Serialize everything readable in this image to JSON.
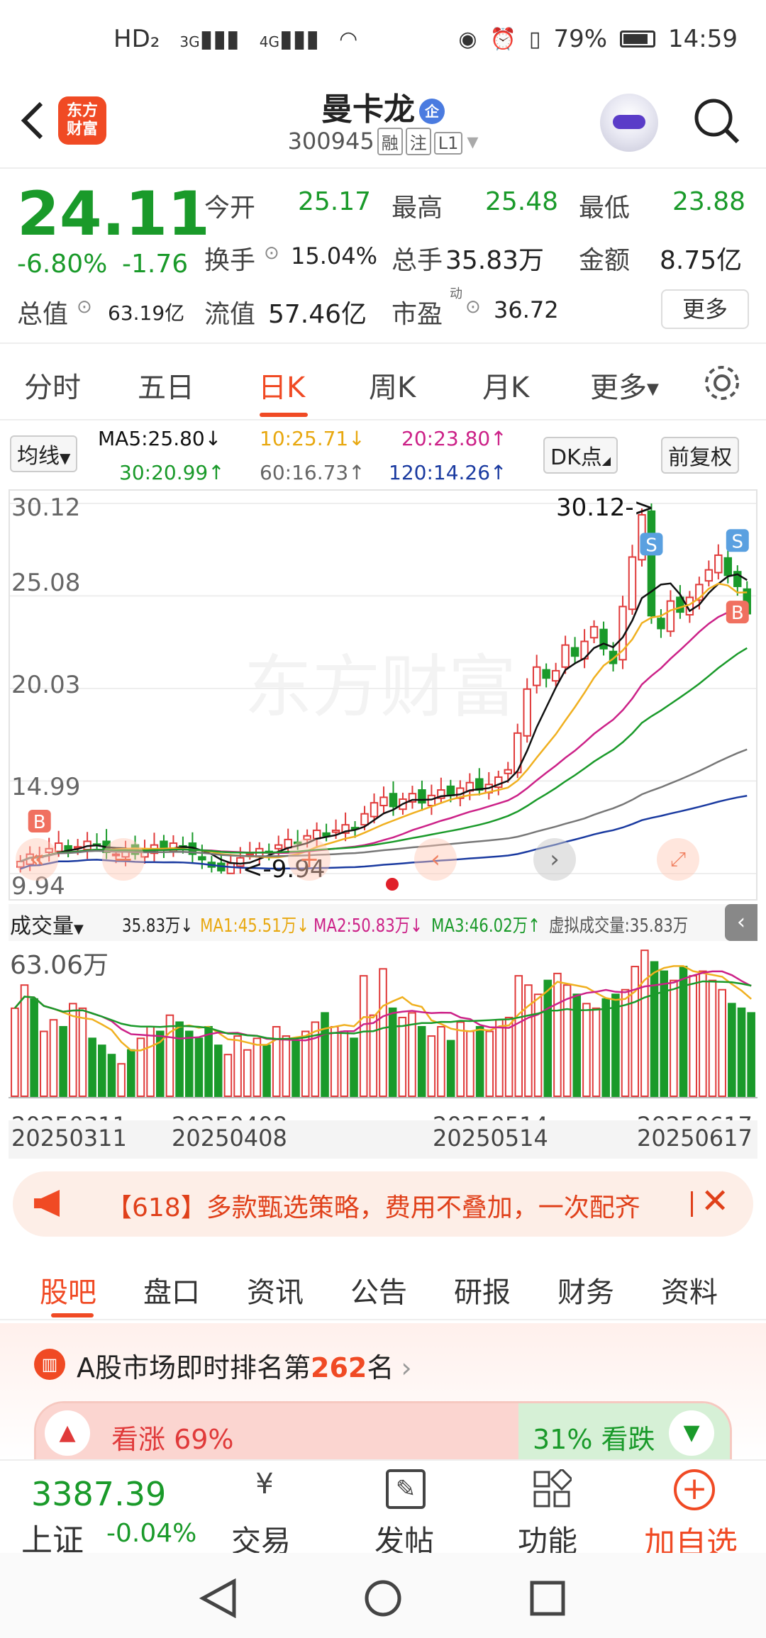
{
  "status_bar": {
    "net1": "HD₂",
    "net2": "3G",
    "net3": "4G",
    "battery": "79%",
    "time": "14:59"
  },
  "header": {
    "logo_text": "东方\n财富",
    "name": "曼卡龙",
    "corp_tag": "企",
    "code": "300945",
    "tags": [
      "融",
      "注",
      "L1"
    ]
  },
  "quote": {
    "price": "24.11",
    "change_pct": "-6.80%",
    "change": "-1.76",
    "open_label": "今开",
    "open": "25.17",
    "high_label": "最高",
    "high": "25.48",
    "low_label": "最低",
    "low": "23.88",
    "turnover_label": "换手",
    "turnover": "15.04%",
    "volume_label": "总手",
    "volume": "35.83万",
    "amount_label": "金额",
    "amount": "8.75亿",
    "mcap_label": "总值",
    "mcap": "63.19亿",
    "float_label": "流值",
    "float": "57.46亿",
    "pe_label": "市盈",
    "pe_sup": "动",
    "pe": "36.72",
    "more": "更多"
  },
  "chart_tabs": {
    "items": [
      "分时",
      "五日",
      "日K",
      "周K",
      "月K",
      "更多"
    ],
    "active": "日K"
  },
  "ma": {
    "selector": "均线",
    "ma5": "MA5:25.80",
    "ma10": "10:25.71",
    "ma20": "20:23.80",
    "ma30": "30:20.99",
    "ma60": "60:16.73",
    "ma120": "120:14.26",
    "dk": "DK点",
    "adjust": "前复权"
  },
  "colors": {
    "up": "#e03a3a",
    "down": "#1a9a2a",
    "accent": "#f04a24",
    "ma5": "#111111",
    "ma10": "#f0b020",
    "ma20": "#cc2288",
    "ma30": "#1a9a2a",
    "ma60": "#777777",
    "ma120": "#1a3aa0"
  },
  "kline": {
    "y_labels": [
      "30.12",
      "25.08",
      "20.03",
      "14.99",
      "9.94"
    ],
    "max_label": "30.12->",
    "min_label": "<-9.94",
    "watermark": "东方财富",
    "chart_data": {
      "type": "candlestick",
      "title": "",
      "ylim": [
        9.94,
        30.12
      ],
      "candles_close": [
        10.6,
        11.0,
        10.9,
        11.3,
        11.6,
        11.2,
        11.4,
        11.7,
        11.5,
        11.1,
        11.0,
        11.3,
        11.0,
        11.2,
        11.5,
        11.3,
        11.6,
        11.4,
        11.0,
        10.7,
        10.3,
        10.1,
        10.5,
        10.8,
        11.0,
        11.3,
        11.1,
        11.5,
        11.8,
        11.6,
        12.0,
        12.3,
        12.0,
        12.3,
        12.6,
        12.4,
        13.2,
        13.8,
        14.1,
        13.6,
        14.0,
        14.3,
        13.8,
        14.2,
        14.5,
        14.2,
        14.6,
        14.9,
        14.5,
        14.8,
        15.2,
        15.6,
        17.6,
        20.0,
        21.2,
        20.6,
        21.0,
        22.4,
        21.8,
        22.6,
        23.4,
        22.2,
        21.4,
        24.5,
        27.2,
        29.5,
        24.0,
        23.3,
        24.8,
        24.2,
        25.0,
        25.7,
        26.5,
        27.3,
        26.2,
        25.6,
        24.11
      ],
      "markers": [
        {
          "label": "B"
        },
        {
          "label": "S"
        },
        {
          "label": "B"
        },
        {
          "label": "S"
        }
      ]
    }
  },
  "volume": {
    "selector": "成交量",
    "cur": "35.83万",
    "ma1": "MA1:45.51万",
    "ma2": "MA2:50.83万",
    "ma3": "MA3:46.02万",
    "virtual": "虚拟成交量:35.83万",
    "max_label": "63.06万",
    "dates": [
      "20250311",
      "20250408",
      "20250514",
      "20250617"
    ],
    "chart_data": {
      "type": "bar",
      "values": [
        38,
        48,
        42,
        28,
        33,
        30,
        40,
        38,
        25,
        22,
        18,
        14,
        20,
        25,
        30,
        28,
        35,
        32,
        28,
        25,
        30,
        22,
        18,
        26,
        20,
        25,
        22,
        30,
        26,
        24,
        28,
        32,
        36,
        30,
        28,
        25,
        52,
        35,
        55,
        38,
        34,
        36,
        30,
        26,
        30,
        24,
        32,
        28,
        30,
        28,
        33,
        34,
        52,
        48,
        44,
        50,
        53,
        48,
        44,
        40,
        38,
        42,
        44,
        46,
        56,
        63,
        58,
        54,
        50,
        56,
        52,
        54,
        50,
        46,
        40,
        38,
        36
      ]
    }
  },
  "banner": {
    "text": "【618】多款甄选策略，费用不叠加，一次配齐"
  },
  "section_tabs": {
    "items": [
      "股吧",
      "盘口",
      "资讯",
      "公告",
      "研报",
      "财务",
      "资料"
    ],
    "active": "股吧"
  },
  "rank": {
    "prefix": "A股市场即时排名第",
    "num": "262",
    "suffix": "名",
    "up": "看涨 69%",
    "down": "31% 看跌"
  },
  "bottom": {
    "index_value": "3387.39",
    "index_name": "上证",
    "index_chg": "-0.04%",
    "trade": "交易",
    "post": "发帖",
    "func": "功能",
    "add": "加自选"
  }
}
